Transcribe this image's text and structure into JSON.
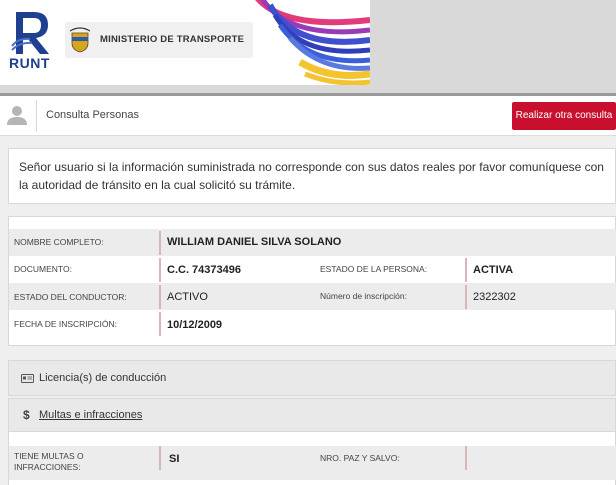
{
  "header": {
    "logo_text": "RUNT",
    "ministry_name": "MINISTERIO DE TRANSPORTE"
  },
  "consulta_bar": {
    "title": "Consulta Personas",
    "redo_button": "Realizar otra consulta"
  },
  "notice": {
    "text": "Señor usuario si la información suministrada no corresponde con sus datos reales por favor comuníquese con la autoridad de tránsito en la cual solicitó su trámite."
  },
  "person": {
    "nombre_label": "NOMBRE COMPLETO:",
    "nombre_value": "WILLIAM DANIEL SILVA SOLANO",
    "documento_label": "DOCUMENTO:",
    "documento_value": "C.C. 74373496",
    "estado_persona_label": "ESTADO DE LA PERSONA:",
    "estado_persona_value": "ACTIVA",
    "estado_conductor_label": "ESTADO DEL CONDUCTOR:",
    "estado_conductor_value": "ACTIVO",
    "inscripcion_num_label": "Número de inscripción:",
    "inscripcion_num_value": "2322302",
    "fecha_label": "FECHA DE INSCRIPCIÓN:",
    "fecha_value": "10/12/2009"
  },
  "sections": {
    "licencias_label": "Licencia(s) de conducción",
    "multas_label": "Multas e infracciones",
    "multas_icon": "$"
  },
  "multas": {
    "tiene_label_1": "TIENE MULTAS O",
    "tiene_label_2": "INFRACCIONES:",
    "tiene_value": "SI",
    "paz_label": "NRO. PAZ Y SALVO:",
    "paz_value": ""
  },
  "colors": {
    "accent_red": "#c8102e",
    "runt_blue": "#1f3f8f"
  }
}
